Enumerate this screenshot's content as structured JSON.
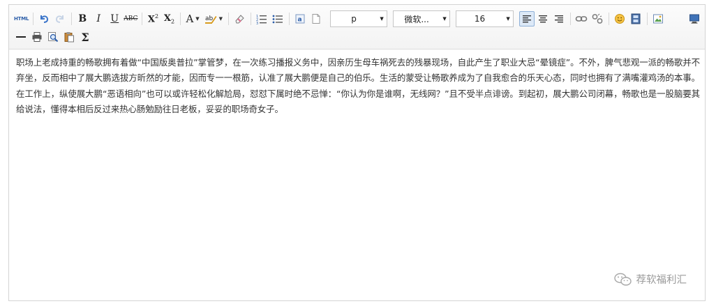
{
  "toolbar": {
    "html_label": "HTML",
    "bold_label": "B",
    "italic_label": "I",
    "underline_label": "U",
    "strike_label": "ABC",
    "superscript_label": "X",
    "superscript_mark": "2",
    "subscript_label": "X",
    "subscript_mark": "2",
    "font_color_label": "A",
    "paragraph_select": "p",
    "font_select": "微软...",
    "size_select": "16",
    "sigma_label": "Σ"
  },
  "content": {
    "paragraph": "职场上老成持重的畅歌拥有着做“中国版奥普拉”掌管梦，在一次练习播报义务中，因亲历生母车祸死去的残暴现场，自此产生了职业大忌“晕镜症”。不外，脾气悲观一派的畅歌并不弃坐，反而相中了展大鹏选拔方昕然的才能，因而专一一根筋，认准了展大鹏便是自己的伯乐。生活的蒙受让畅歌养成为了自我愈合的乐天心态，同时也拥有了满嘴灌鸡汤的本事。在工作上，纵使展大鹏“恶语相向”也可以或许轻松化解尬局，怼怼下属时绝不忌惮：“你认为你是谁啊，无线网？”且不受半点诽谤。到起初，展大鹏公司闭幕，畅歌也是一股脑要其给说法，懂得本相后反过来热心肠勉励往日老板，妥妥的职场奇女子。"
  },
  "watermark": {
    "text": "荐软福利汇"
  },
  "icons": [
    "html-source-icon",
    "undo-icon",
    "redo-icon",
    "bold-icon",
    "italic-icon",
    "underline-icon",
    "strikethrough-icon",
    "superscript-icon",
    "subscript-icon",
    "font-color-icon",
    "highlight-icon",
    "eraser-icon",
    "ordered-list-icon",
    "unordered-list-icon",
    "paste-text-icon",
    "blank-page-icon",
    "align-left-icon",
    "align-center-icon",
    "align-right-icon",
    "link-icon",
    "unlink-icon",
    "emoticon-icon",
    "video-icon",
    "image-icon",
    "preview-icon",
    "horizontal-rule-icon",
    "print-icon",
    "search-replace-icon",
    "paste-word-icon",
    "formula-icon",
    "wechat-icon"
  ],
  "colors": {
    "accent": "#2b5da8",
    "active_button_bg": "#dde9f7",
    "text": "#333333",
    "watermark": "#9a9a9a"
  }
}
